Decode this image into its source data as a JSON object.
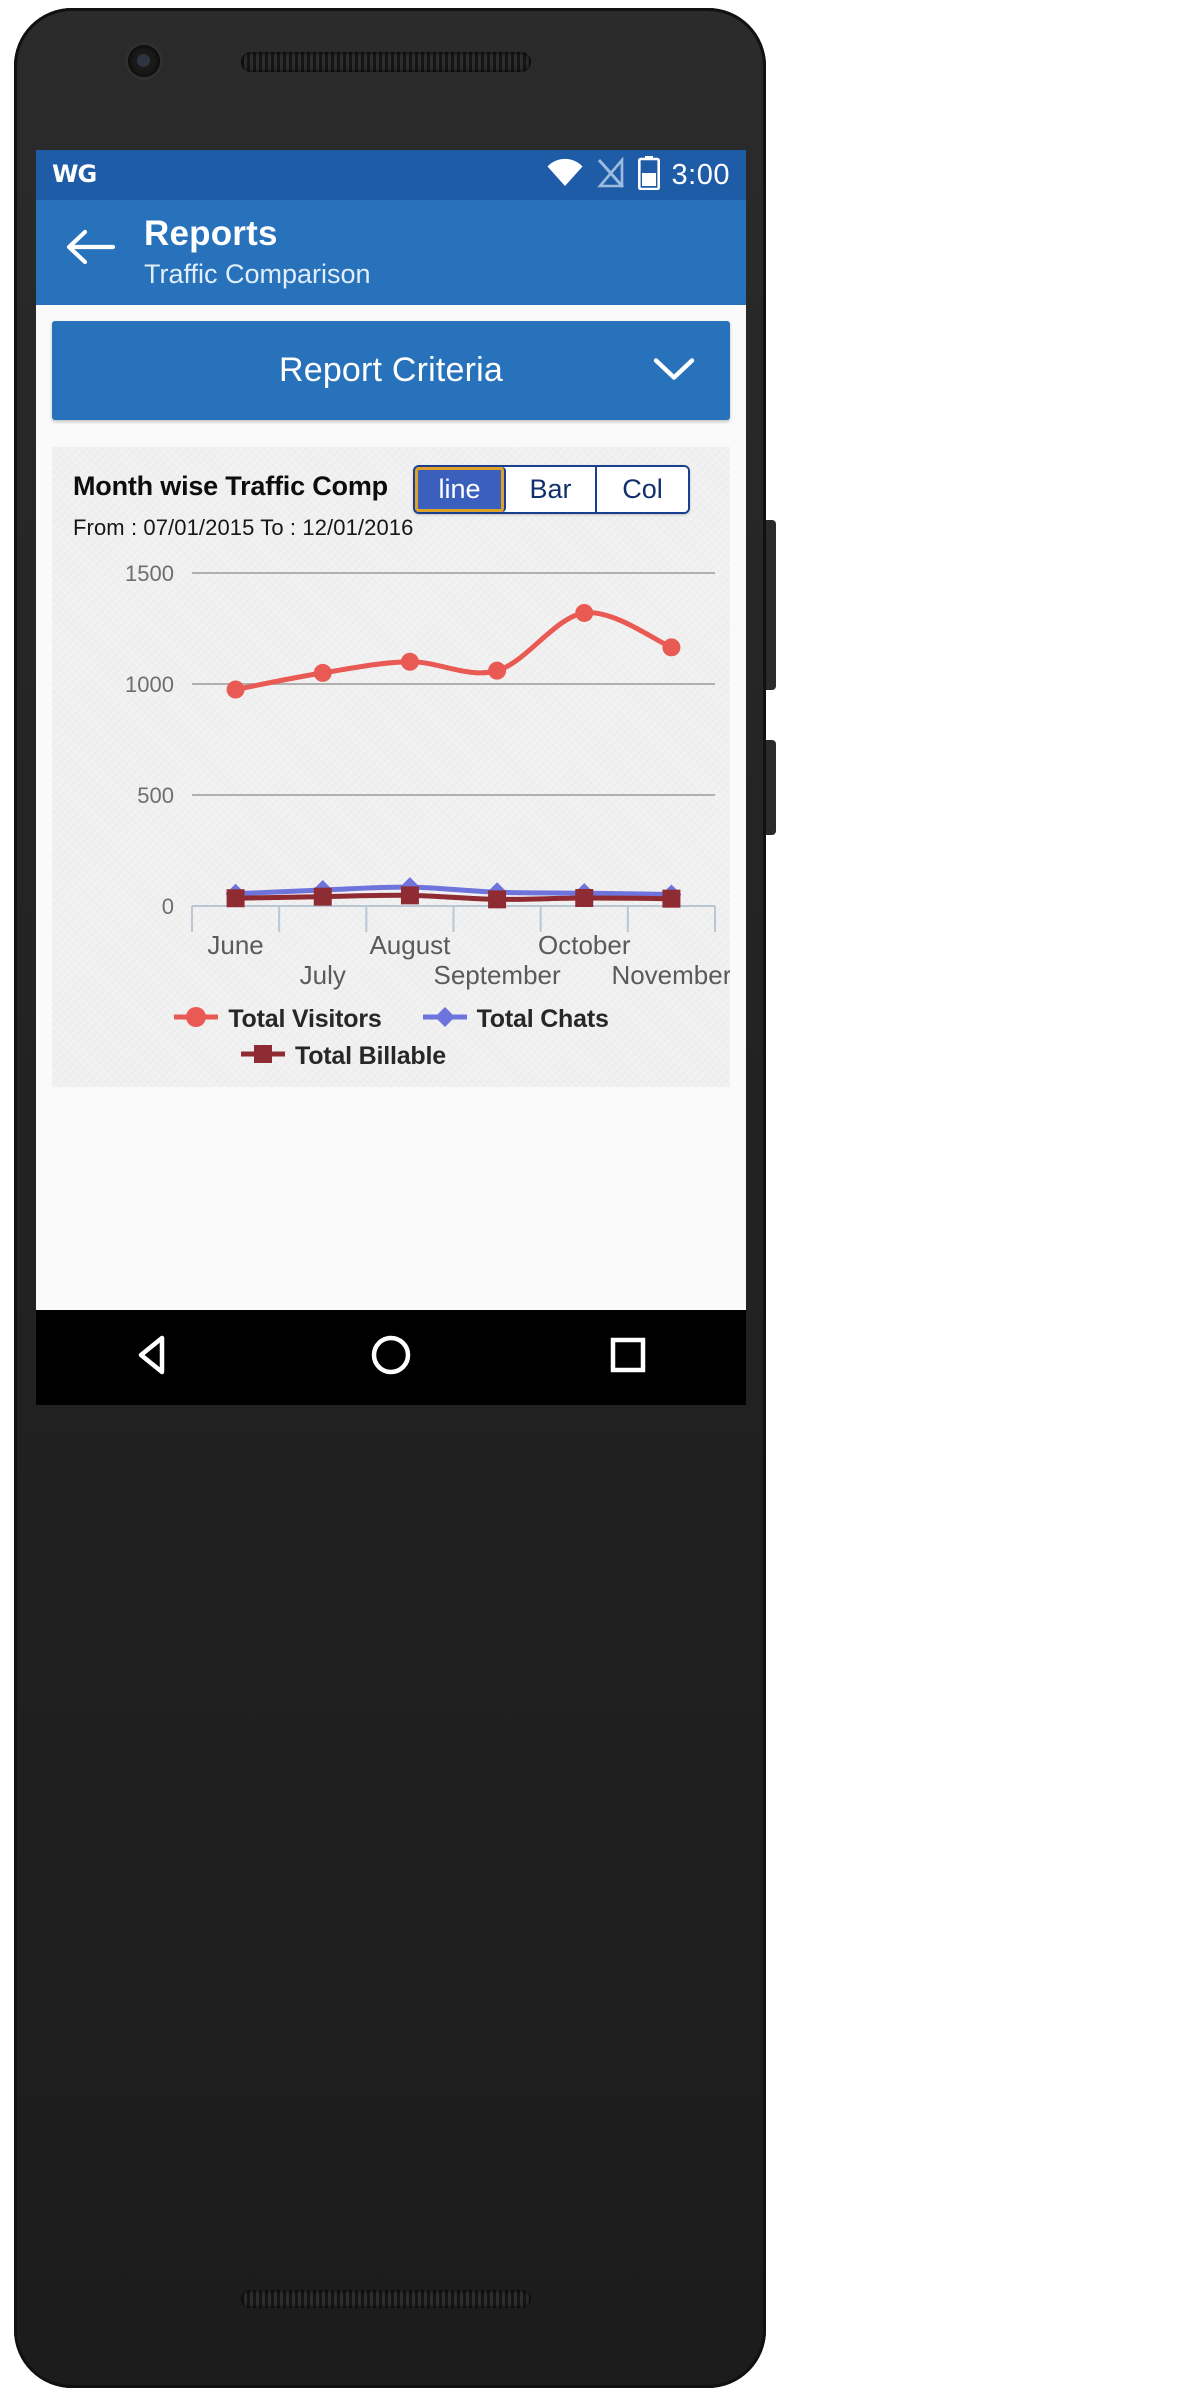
{
  "status_bar": {
    "logo_text": "WG",
    "time": "3:00",
    "icons": [
      "wifi-icon",
      "signal-off-icon",
      "battery-icon"
    ]
  },
  "app_bar": {
    "back_icon": "back-arrow-icon",
    "title": "Reports",
    "subtitle": "Traffic Comparison"
  },
  "criteria_panel": {
    "label": "Report Criteria",
    "expand_icon": "chevron-down-icon"
  },
  "chart_card": {
    "title": "Month wise Traffic Comp",
    "date_range": "From : 07/01/2015 To : 12/01/2016",
    "chart_type_buttons": [
      {
        "label": "line",
        "active": true
      },
      {
        "label": "Bar",
        "active": false
      },
      {
        "label": "Col",
        "active": false
      }
    ]
  },
  "navigation_bar": {
    "back": "nav-back-triangle-icon",
    "home": "nav-home-circle-icon",
    "recents": "nav-recents-square-icon"
  },
  "colors": {
    "brand_blue": "#2772bb",
    "status_blue": "#1f5ca8",
    "total_visitors": "#ea5a54",
    "total_chats": "#6f74dd",
    "total_billable": "#8f2b32",
    "segment_active_bg": "#3a5fbd",
    "segment_active_border": "#e0a12a",
    "segment_border": "#1b3f8f"
  },
  "chart_data": {
    "type": "line",
    "title": "Month wise Traffic Comp",
    "subtitle": "From : 07/01/2015 To : 12/01/2016",
    "xlabel": "",
    "ylabel": "",
    "ylim": [
      0,
      1500
    ],
    "yticks": [
      0,
      500,
      1000,
      1500
    ],
    "ytick_labels": [
      "0",
      "500",
      "1000",
      "1500"
    ],
    "grid": true,
    "legend_position": "bottom",
    "categories": [
      "June",
      "July",
      "August",
      "September",
      "October",
      "November"
    ],
    "series": [
      {
        "name": "Total Visitors",
        "color": "#ea5a54",
        "marker": "circle",
        "values": [
          975,
          1050,
          1100,
          1060,
          1320,
          1165
        ]
      },
      {
        "name": "Total Chats",
        "color": "#6f74dd",
        "marker": "diamond",
        "values": [
          55,
          72,
          85,
          62,
          58,
          52
        ]
      },
      {
        "name": "Total Billable",
        "color": "#8f2b32",
        "marker": "square",
        "values": [
          35,
          42,
          48,
          30,
          36,
          33
        ]
      }
    ]
  }
}
